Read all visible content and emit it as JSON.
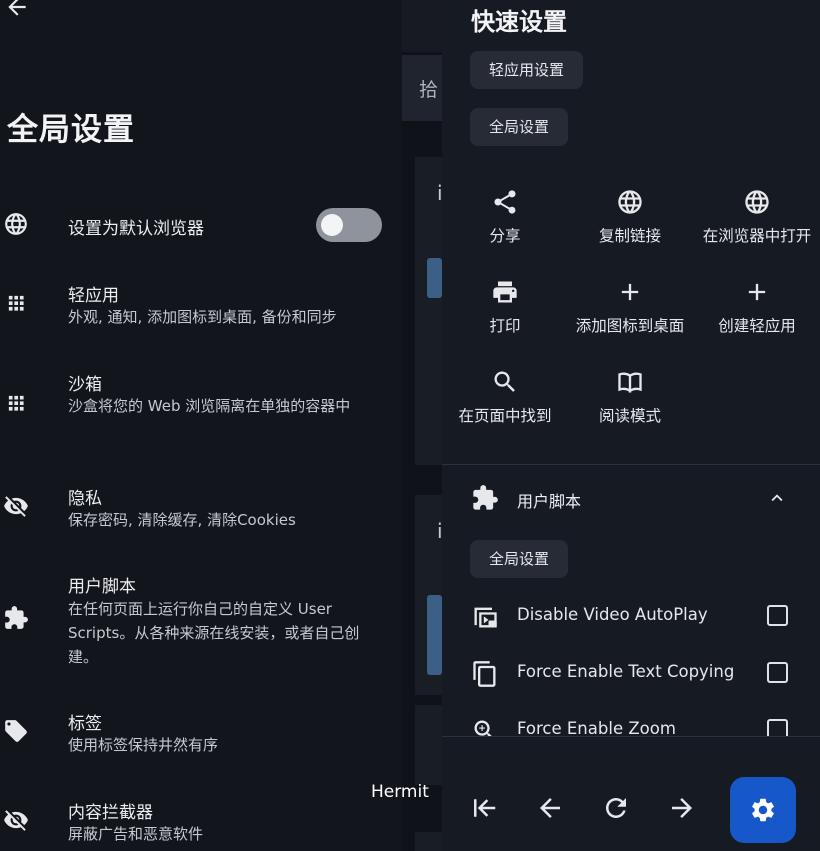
{
  "left_panel": {
    "title": "全局设置",
    "rows": [
      {
        "title": "设置为默认浏览器",
        "toggle_on": false,
        "icon": "globe-icon"
      },
      {
        "title": "轻应用",
        "subtitle": "外观, 通知, 添加图标到桌面, 备份和同步",
        "icon": "apps-grid-icon"
      },
      {
        "title": "沙箱",
        "subtitle": "沙盒将您的 Web 浏览隔离在单独的容器中",
        "icon": "apps-grid-icon"
      },
      {
        "title": "隐私",
        "subtitle": "保存密码, 清除缓存, 清除Cookies",
        "icon": "eye-off-icon"
      },
      {
        "title": "用户脚本",
        "subtitle": "在任何页面上运行你自己的自定义 User Scripts。从各种来源在线安装，或者自己创建。",
        "icon": "puzzle-icon"
      },
      {
        "title": "标签",
        "subtitle": "使用标签保持井然有序",
        "icon": "tag-icon"
      },
      {
        "title": "内容拦截器",
        "subtitle": "屏蔽广告和恶意软件",
        "icon": "eye-off-icon"
      }
    ]
  },
  "background": {
    "tab_fragment": "拾",
    "card_fragment_1": "i",
    "card_fragment_2": "i"
  },
  "quick_settings": {
    "title": "快速设置",
    "chips": [
      "轻应用设置",
      "全局设置"
    ],
    "actions": [
      {
        "label": "分享",
        "icon": "share-icon"
      },
      {
        "label": "复制链接",
        "icon": "globe-icon"
      },
      {
        "label": "在浏览器中打开",
        "icon": "globe-icon"
      },
      {
        "label": "打印",
        "icon": "print-icon"
      },
      {
        "label": "添加图标到桌面",
        "icon": "plus-icon"
      },
      {
        "label": "创建轻应用",
        "icon": "plus-icon"
      },
      {
        "label": "在页面中找到",
        "icon": "search-icon"
      },
      {
        "label": "阅读模式",
        "icon": "book-icon"
      }
    ],
    "user_scripts": {
      "header": "用户脚本",
      "expanded": true,
      "chip": "全局设置",
      "items": [
        {
          "name": "Disable Video AutoPlay",
          "checked": false,
          "icon": "video-lock-icon"
        },
        {
          "name": "Force Enable Text Copying",
          "checked": false,
          "icon": "copy-icon"
        },
        {
          "name": "Force Enable Zoom",
          "checked": false,
          "icon": "zoom-in-icon"
        }
      ]
    },
    "nav": [
      "first-page-icon",
      "back-arrow-icon",
      "refresh-icon",
      "forward-arrow-icon",
      "settings-gear-icon"
    ]
  },
  "overlay_label": "Hermit",
  "colors": {
    "accent": "#1657c9",
    "panel": "#161a23",
    "background": "#12151c",
    "chip": "#262b36"
  }
}
